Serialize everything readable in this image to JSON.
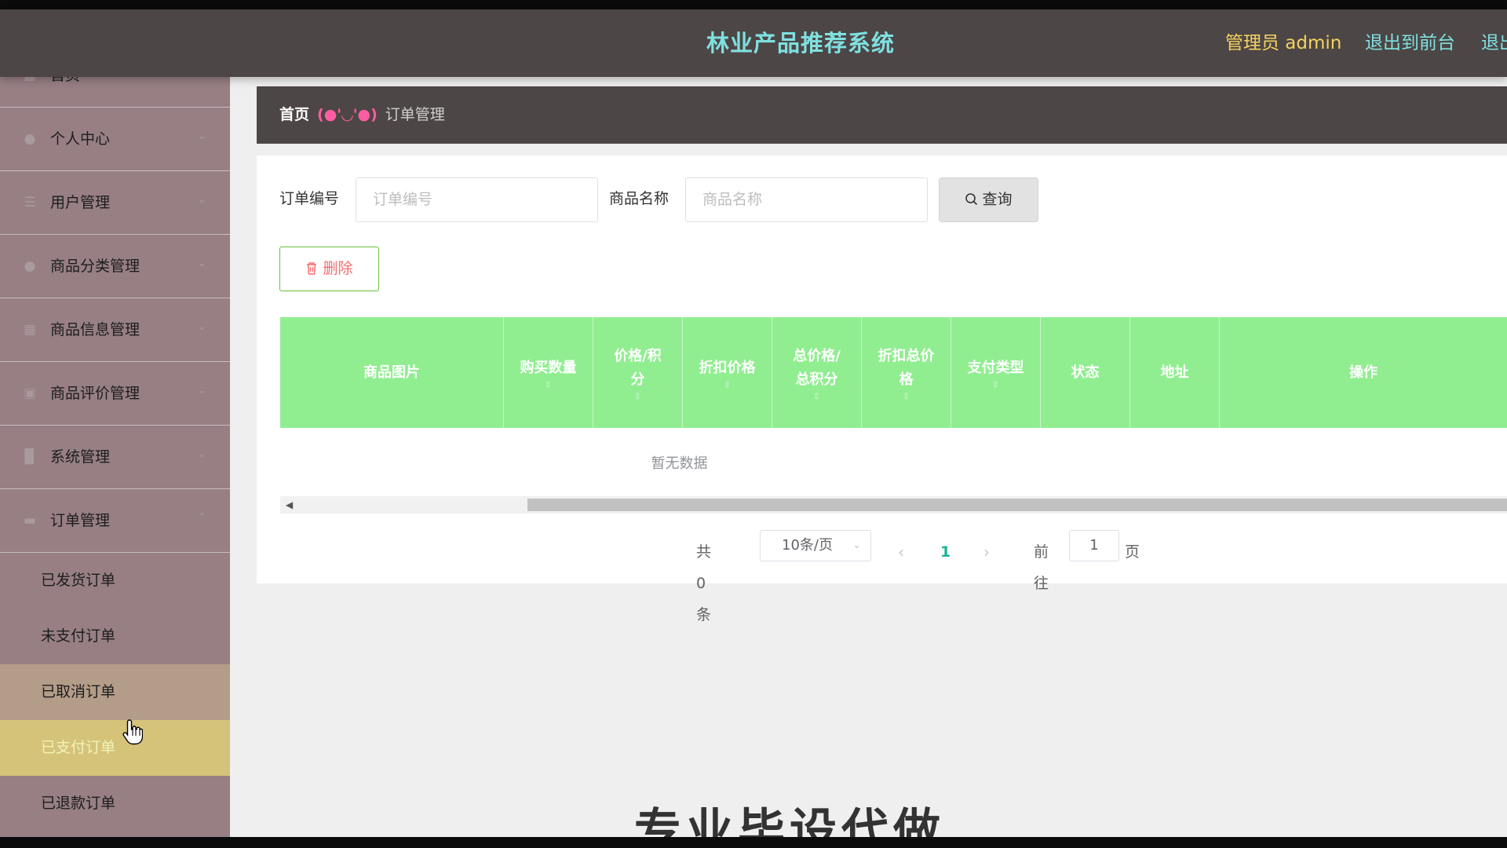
{
  "header": {
    "title": "林业产品推荐系统",
    "user": "管理员 admin",
    "front": "退出到前台",
    "exit": "退出登录"
  },
  "sidebar": {
    "items": [
      {
        "label": "首页",
        "icon": "home-icon"
      },
      {
        "label": "个人中心",
        "icon": "user-icon"
      },
      {
        "label": "用户管理",
        "icon": "list-icon"
      },
      {
        "label": "商品分类管理",
        "icon": "user-icon"
      },
      {
        "label": "商品信息管理",
        "icon": "grid-icon"
      },
      {
        "label": "商品评价管理",
        "icon": "edit-icon"
      },
      {
        "label": "系统管理",
        "icon": "chart-icon"
      },
      {
        "label": "订单管理",
        "icon": "order-icon"
      }
    ],
    "sub_items": [
      "已发货订单",
      "未支付订单",
      "已取消订单",
      "已支付订单",
      "已退款订单"
    ]
  },
  "breadcrumb": {
    "home": "首页",
    "separator": "(●'◡'●)",
    "current": "订单管理"
  },
  "search": {
    "order_no_label": "订单编号",
    "order_no_placeholder": "订单编号",
    "product_label": "商品名称",
    "product_placeholder": "商品名称",
    "query_button": "查询"
  },
  "actions": {
    "delete_button": "删除"
  },
  "table": {
    "columns": [
      {
        "label": "商品图片"
      },
      {
        "label": "购买数量"
      },
      {
        "label": "价格/积分"
      },
      {
        "label": "折扣价格"
      },
      {
        "label": "总价格/总积分"
      },
      {
        "label": "折扣总价格"
      },
      {
        "label": "支付类型"
      },
      {
        "label": "状态"
      },
      {
        "label": "地址"
      },
      {
        "label": "操作"
      }
    ],
    "empty_text": "暂无数据"
  },
  "pagination": {
    "total": "共 0 条",
    "page_size": "10条/页",
    "current_page": "1",
    "goto_label": "前往",
    "goto_value": "1",
    "page_suffix": "页"
  },
  "watermark": "专业毕设代做",
  "colors": {
    "header_bg": "#4d4646",
    "title": "#7fe0e0",
    "user": "#f4d35e",
    "sidebar_bg": "#977f84",
    "sidebar_active": "#d6c37a",
    "table_header": "#90ee90",
    "page_active": "#1ab394",
    "delete_text": "#f56c6c"
  }
}
